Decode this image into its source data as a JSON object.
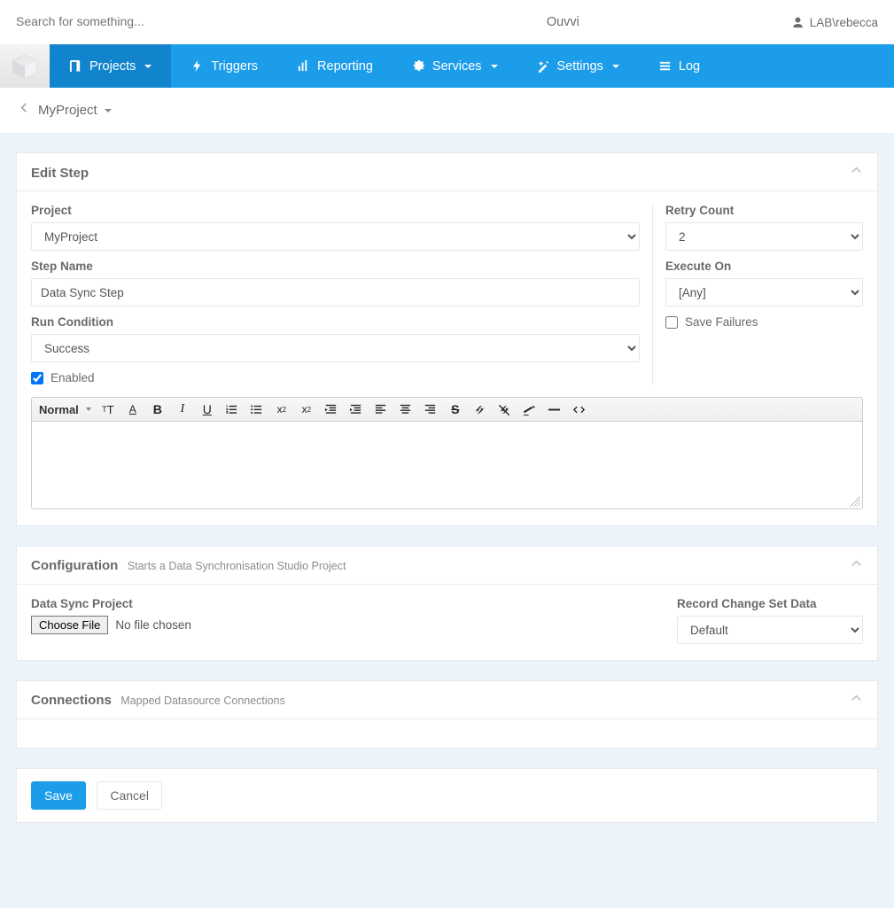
{
  "header": {
    "search_placeholder": "Search for something...",
    "brand": "Ouvvi",
    "user_label": "LAB\\rebecca"
  },
  "nav": {
    "items": [
      {
        "label": "Projects",
        "has_caret": true,
        "active": true
      },
      {
        "label": "Triggers",
        "has_caret": false,
        "active": false
      },
      {
        "label": "Reporting",
        "has_caret": false,
        "active": false
      },
      {
        "label": "Services",
        "has_caret": true,
        "active": false
      },
      {
        "label": "Settings",
        "has_caret": true,
        "active": false
      },
      {
        "label": "Log",
        "has_caret": false,
        "active": false
      }
    ]
  },
  "breadcrumb": {
    "project_name": "MyProject"
  },
  "edit_step": {
    "title": "Edit Step",
    "project_label": "Project",
    "project_value": "MyProject",
    "step_name_label": "Step Name",
    "step_name_value": "Data Sync Step",
    "run_condition_label": "Run Condition",
    "run_condition_value": "Success",
    "enabled_label": "Enabled",
    "enabled_checked": true,
    "retry_count_label": "Retry Count",
    "retry_count_value": "2",
    "execute_on_label": "Execute On",
    "execute_on_value": "[Any]",
    "save_failures_label": "Save Failures",
    "save_failures_checked": false,
    "editor": {
      "style_label": "Normal",
      "content": ""
    }
  },
  "configuration": {
    "title": "Configuration",
    "subtitle": "Starts a Data Synchronisation Studio Project",
    "data_sync_label": "Data Sync Project",
    "choose_file_label": "Choose File",
    "no_file_label": "No file chosen",
    "record_change_label": "Record Change Set Data",
    "record_change_value": "Default"
  },
  "connections": {
    "title": "Connections",
    "subtitle": "Mapped Datasource Connections"
  },
  "footer": {
    "save_label": "Save",
    "cancel_label": "Cancel"
  }
}
